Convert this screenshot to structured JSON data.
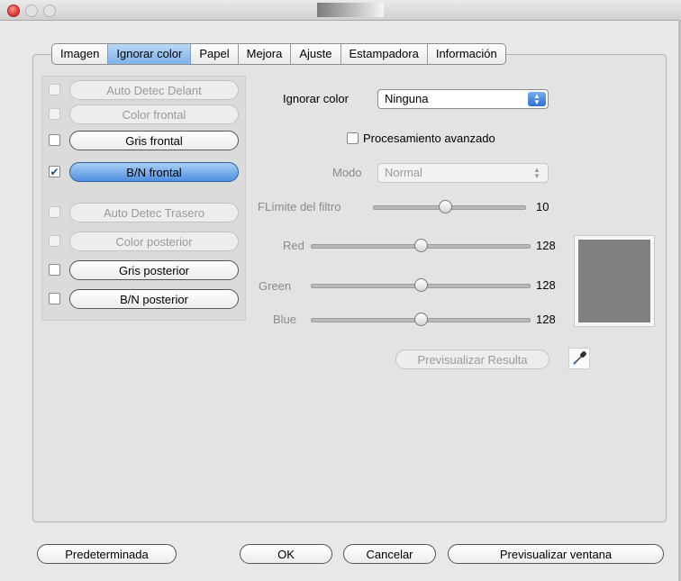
{
  "tabs": [
    "Imagen",
    "Ignorar color",
    "Papel",
    "Mejora",
    "Ajuste",
    "Estampadora",
    "Información"
  ],
  "left_options": [
    {
      "label": "Auto Detec Delant",
      "checked": false,
      "enabled": false
    },
    {
      "label": "Color frontal",
      "checked": false,
      "enabled": false
    },
    {
      "label": "Gris frontal",
      "checked": false,
      "enabled": true
    },
    {
      "label": "B/N frontal",
      "checked": true,
      "enabled": true
    },
    {
      "label": "Auto Detec Trasero",
      "checked": false,
      "enabled": false
    },
    {
      "label": "Color posterior",
      "checked": false,
      "enabled": false
    },
    {
      "label": "Gris posterior",
      "checked": false,
      "enabled": true
    },
    {
      "label": "B/N posterior",
      "checked": false,
      "enabled": true
    }
  ],
  "ignore_color": {
    "label": "Ignorar color",
    "value": "Ninguna"
  },
  "advanced": {
    "label": "Procesamiento avanzado",
    "checked": false
  },
  "mode": {
    "label": "Modo",
    "value": "Normal"
  },
  "filter": {
    "label": "FLímite del filtro",
    "value": "10",
    "fraction": 0.47
  },
  "red": {
    "label": "Red",
    "value": "128",
    "fraction": 0.5
  },
  "green": {
    "label": "Green",
    "value": "128",
    "fraction": 0.5
  },
  "blue": {
    "label": "Blue",
    "value": "128",
    "fraction": 0.5
  },
  "preview_result": "Previsualizar Resulta",
  "swatch_color": "#808080",
  "buttons": {
    "default": "Predeterminada",
    "ok": "OK",
    "cancel": "Cancelar",
    "preview_window": "Previsualizar ventana"
  },
  "check_mark": "✔",
  "arrows": {
    "up": "▲",
    "down": "▼"
  }
}
